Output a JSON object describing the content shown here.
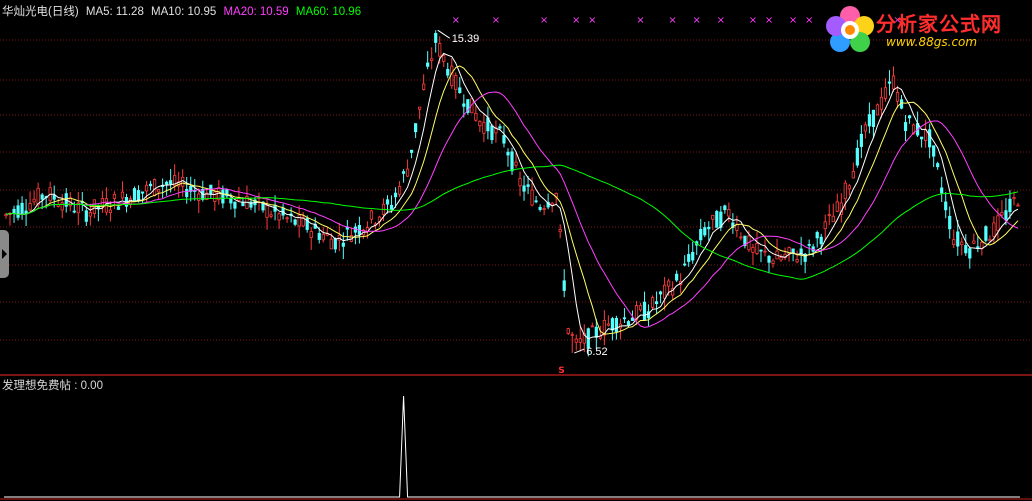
{
  "header": {
    "stock_label": "华灿光电(日线)",
    "ma5_label": "MA5: 11.28",
    "ma10_label": "MA10: 10.95",
    "ma20_label": "MA20: 10.59",
    "ma60_label": "MA60: 10.96"
  },
  "indicator": {
    "label": "发理想免费帖 : 0.00"
  },
  "logo": {
    "title": "分析家公式网",
    "url": "www.88gs.com"
  },
  "colors": {
    "up": "#ff3c3c",
    "down": "#54ffff",
    "ma5": "#ffffff",
    "ma10": "#ffff66",
    "ma20": "#ff40ff",
    "ma60": "#00ff00",
    "grid": "#7a1616",
    "marker": "#ff40ff"
  },
  "chart_data": {
    "type": "candlestick",
    "high_annotation": "15.39",
    "low_annotation": "6.52",
    "low_marker": "S",
    "ma_values": {
      "MA5": 11.28,
      "MA10": 10.95,
      "MA20": 10.59,
      "MA60": 10.96
    },
    "price_range": [
      6.52,
      15.39
    ],
    "trend_anchors": [
      [
        0,
        10.3
      ],
      [
        10,
        10.9
      ],
      [
        20,
        10.4
      ],
      [
        30,
        10.8
      ],
      [
        40,
        11.2
      ],
      [
        50,
        10.9
      ],
      [
        60,
        10.7
      ],
      [
        70,
        10.2
      ],
      [
        75,
        10.0
      ],
      [
        82,
        9.6
      ],
      [
        90,
        10.1
      ],
      [
        96,
        10.6
      ],
      [
        100,
        11.6
      ],
      [
        104,
        13.8
      ],
      [
        107,
        15.1
      ],
      [
        112,
        13.9
      ],
      [
        118,
        12.9
      ],
      [
        124,
        12.4
      ],
      [
        128,
        11.2
      ],
      [
        133,
        10.6
      ],
      [
        137,
        10.9
      ],
      [
        140,
        7.2
      ],
      [
        142,
        6.7
      ],
      [
        150,
        7.3
      ],
      [
        160,
        7.7
      ],
      [
        168,
        8.6
      ],
      [
        174,
        9.9
      ],
      [
        180,
        10.4
      ],
      [
        186,
        9.3
      ],
      [
        192,
        9.1
      ],
      [
        200,
        9.3
      ],
      [
        208,
        10.6
      ],
      [
        214,
        12.6
      ],
      [
        221,
        14.0
      ],
      [
        224,
        12.9
      ],
      [
        230,
        12.4
      ],
      [
        236,
        9.7
      ],
      [
        240,
        9.4
      ],
      [
        246,
        9.9
      ],
      [
        252,
        10.8
      ]
    ],
    "indicator_signal_index": 99,
    "indicator_signal_value": 1
  }
}
